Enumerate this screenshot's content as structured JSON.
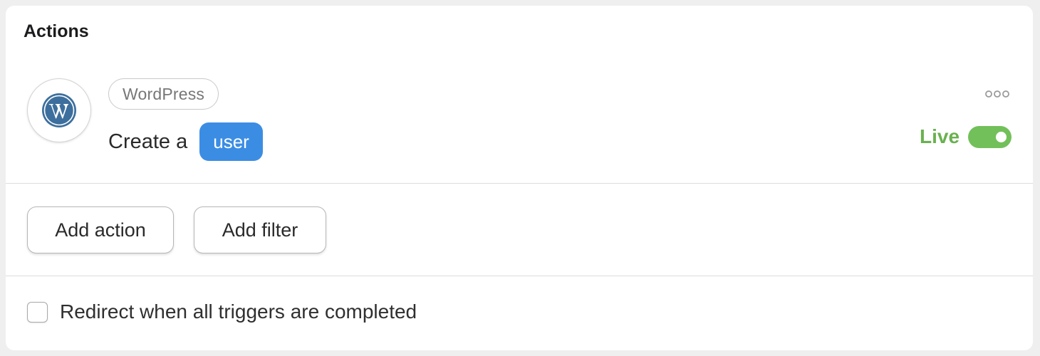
{
  "section": {
    "title": "Actions"
  },
  "action": {
    "integration": "WordPress",
    "integration_icon": "wordpress-logo-icon",
    "sentence_prefix": "Create a",
    "token": "user",
    "status_label": "Live",
    "status_enabled": true,
    "menu_icon": "more-horizontal-icon"
  },
  "buttons": {
    "add_action": "Add action",
    "add_filter": "Add filter"
  },
  "redirect": {
    "label": "Redirect when all triggers are completed",
    "checked": false
  },
  "colors": {
    "token_bg": "#3b8de4",
    "live_text": "#6ab150",
    "toggle_on": "#72c05a",
    "wordpress_blue": "#3c6f9d"
  }
}
